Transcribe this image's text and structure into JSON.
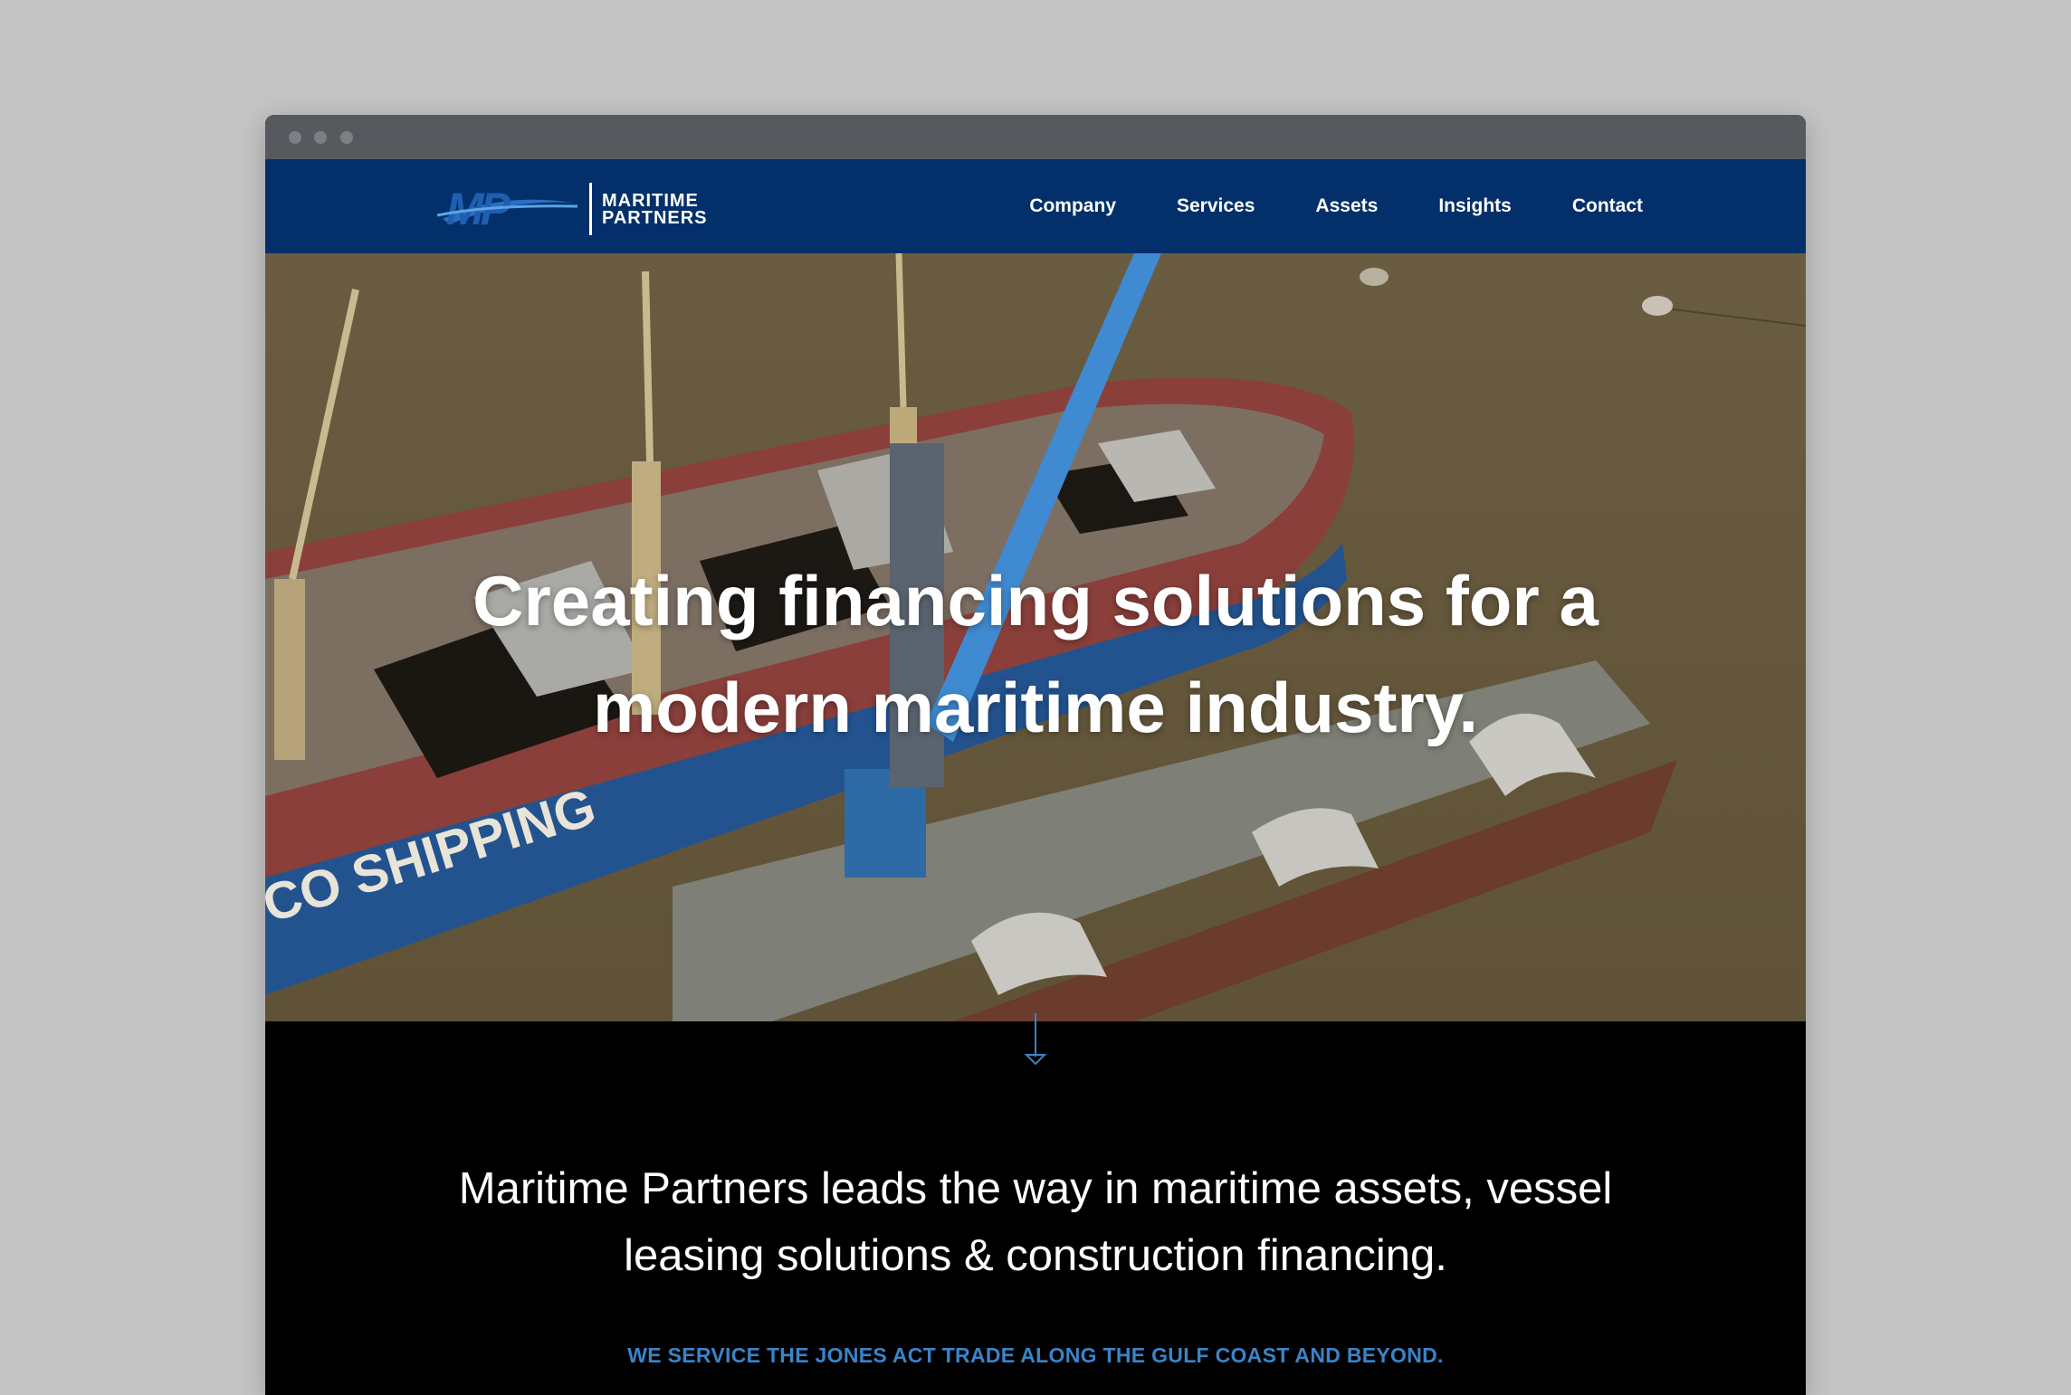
{
  "brand": {
    "mark": "MP",
    "line1": "MARITIME",
    "line2": "PARTNERS",
    "primary_color": "#03306a",
    "accent_color": "#3a84c8"
  },
  "nav": {
    "items": [
      {
        "label": "Company"
      },
      {
        "label": "Services"
      },
      {
        "label": "Assets"
      },
      {
        "label": "Insights"
      },
      {
        "label": "Contact"
      }
    ]
  },
  "hero": {
    "title_line1": "Creating financing solutions for a",
    "title_line2": "modern maritime industry.",
    "hull_text": "CO SHIPPING",
    "scroll_icon": "arrow-down-icon"
  },
  "intro": {
    "line1": "Maritime Partners leads the way in maritime assets, vessel",
    "line2": "leasing solutions & construction financing."
  },
  "tagline": "WE SERVICE THE JONES ACT TRADE ALONG THE GULF COAST AND BEYOND."
}
